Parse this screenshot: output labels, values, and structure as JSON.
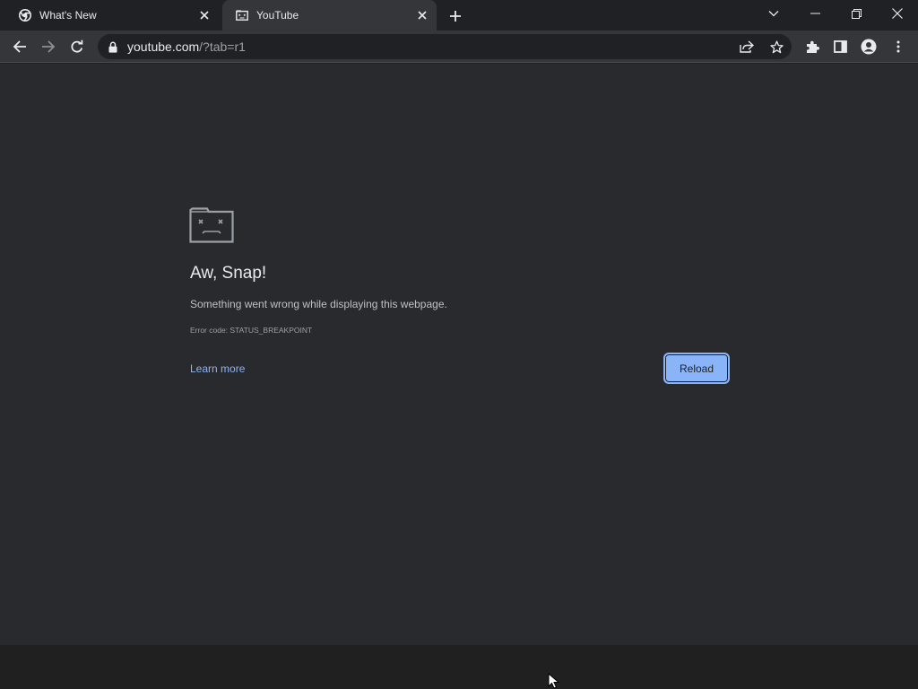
{
  "tabs": [
    {
      "title": "What's New",
      "favicon": "chrome-logo-icon",
      "active": false
    },
    {
      "title": "YouTube",
      "favicon": "sad-tab-icon",
      "active": true
    }
  ],
  "address_bar": {
    "host": "youtube.com",
    "path": "/?tab=r1"
  },
  "error_page": {
    "heading": "Aw, Snap!",
    "message": "Something went wrong while displaying this webpage.",
    "error_code": "Error code: STATUS_BREAKPOINT",
    "learn_more": "Learn more",
    "reload_label": "Reload"
  },
  "colors": {
    "accent": "#8ab4f8",
    "content_bg": "#292a2d",
    "toolbar_bg": "#35363a",
    "frame_bg": "#202124"
  }
}
